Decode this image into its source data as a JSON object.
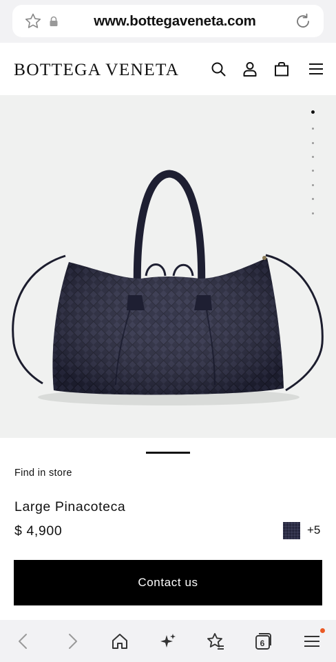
{
  "browser": {
    "url": "www.bottegaveneta.com",
    "tab_count": "6",
    "icons": {
      "favorite": "star-icon",
      "secure": "lock-icon",
      "reload": "reload-icon",
      "back": "back-arrow-icon",
      "forward": "forward-arrow-icon",
      "home": "home-icon",
      "ai": "sparkle-icon",
      "bookmarks": "bookmarks-icon",
      "tabs": "tabs-icon",
      "menu": "menu-icon"
    },
    "notification_color": "#ea5a25"
  },
  "header": {
    "logo": "BOTTEGA VENETA",
    "icons": [
      "search-icon",
      "account-icon",
      "bag-icon",
      "hamburger-menu-icon"
    ]
  },
  "gallery": {
    "image_count": 8,
    "active_index": 0,
    "background": "#f0f1f0",
    "bag_color": "#24253b"
  },
  "product": {
    "find_in_store": "Find in store",
    "name": "Large Pinacoteca",
    "price": "$ 4,900",
    "more_colors": "+5",
    "contact_label": "Contact us"
  }
}
